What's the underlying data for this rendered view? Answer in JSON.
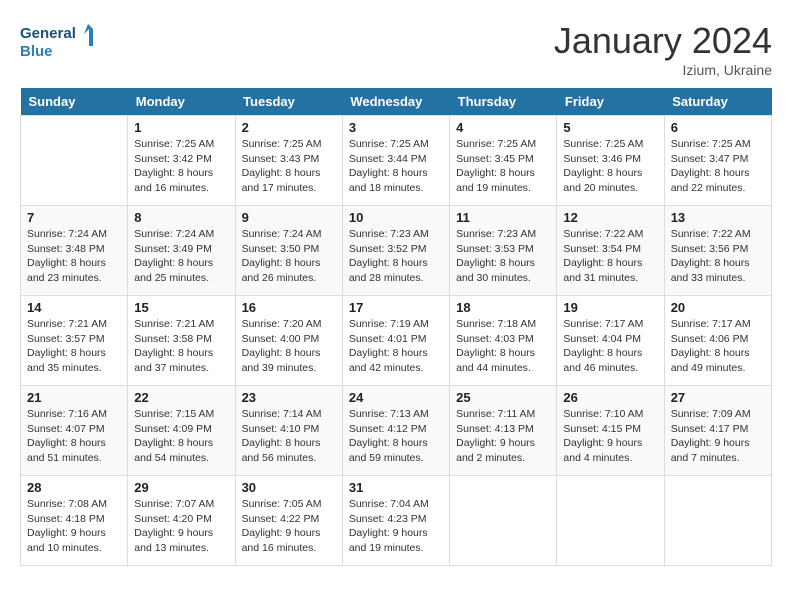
{
  "header": {
    "logo_line1": "General",
    "logo_line2": "Blue",
    "month_title": "January 2024",
    "location": "Izium, Ukraine"
  },
  "weekdays": [
    "Sunday",
    "Monday",
    "Tuesday",
    "Wednesday",
    "Thursday",
    "Friday",
    "Saturday"
  ],
  "weeks": [
    [
      {
        "day": "",
        "info": ""
      },
      {
        "day": "1",
        "info": "Sunrise: 7:25 AM\nSunset: 3:42 PM\nDaylight: 8 hours\nand 16 minutes."
      },
      {
        "day": "2",
        "info": "Sunrise: 7:25 AM\nSunset: 3:43 PM\nDaylight: 8 hours\nand 17 minutes."
      },
      {
        "day": "3",
        "info": "Sunrise: 7:25 AM\nSunset: 3:44 PM\nDaylight: 8 hours\nand 18 minutes."
      },
      {
        "day": "4",
        "info": "Sunrise: 7:25 AM\nSunset: 3:45 PM\nDaylight: 8 hours\nand 19 minutes."
      },
      {
        "day": "5",
        "info": "Sunrise: 7:25 AM\nSunset: 3:46 PM\nDaylight: 8 hours\nand 20 minutes."
      },
      {
        "day": "6",
        "info": "Sunrise: 7:25 AM\nSunset: 3:47 PM\nDaylight: 8 hours\nand 22 minutes."
      }
    ],
    [
      {
        "day": "7",
        "info": "Sunrise: 7:24 AM\nSunset: 3:48 PM\nDaylight: 8 hours\nand 23 minutes."
      },
      {
        "day": "8",
        "info": "Sunrise: 7:24 AM\nSunset: 3:49 PM\nDaylight: 8 hours\nand 25 minutes."
      },
      {
        "day": "9",
        "info": "Sunrise: 7:24 AM\nSunset: 3:50 PM\nDaylight: 8 hours\nand 26 minutes."
      },
      {
        "day": "10",
        "info": "Sunrise: 7:23 AM\nSunset: 3:52 PM\nDaylight: 8 hours\nand 28 minutes."
      },
      {
        "day": "11",
        "info": "Sunrise: 7:23 AM\nSunset: 3:53 PM\nDaylight: 8 hours\nand 30 minutes."
      },
      {
        "day": "12",
        "info": "Sunrise: 7:22 AM\nSunset: 3:54 PM\nDaylight: 8 hours\nand 31 minutes."
      },
      {
        "day": "13",
        "info": "Sunrise: 7:22 AM\nSunset: 3:56 PM\nDaylight: 8 hours\nand 33 minutes."
      }
    ],
    [
      {
        "day": "14",
        "info": "Sunrise: 7:21 AM\nSunset: 3:57 PM\nDaylight: 8 hours\nand 35 minutes."
      },
      {
        "day": "15",
        "info": "Sunrise: 7:21 AM\nSunset: 3:58 PM\nDaylight: 8 hours\nand 37 minutes."
      },
      {
        "day": "16",
        "info": "Sunrise: 7:20 AM\nSunset: 4:00 PM\nDaylight: 8 hours\nand 39 minutes."
      },
      {
        "day": "17",
        "info": "Sunrise: 7:19 AM\nSunset: 4:01 PM\nDaylight: 8 hours\nand 42 minutes."
      },
      {
        "day": "18",
        "info": "Sunrise: 7:18 AM\nSunset: 4:03 PM\nDaylight: 8 hours\nand 44 minutes."
      },
      {
        "day": "19",
        "info": "Sunrise: 7:17 AM\nSunset: 4:04 PM\nDaylight: 8 hours\nand 46 minutes."
      },
      {
        "day": "20",
        "info": "Sunrise: 7:17 AM\nSunset: 4:06 PM\nDaylight: 8 hours\nand 49 minutes."
      }
    ],
    [
      {
        "day": "21",
        "info": "Sunrise: 7:16 AM\nSunset: 4:07 PM\nDaylight: 8 hours\nand 51 minutes."
      },
      {
        "day": "22",
        "info": "Sunrise: 7:15 AM\nSunset: 4:09 PM\nDaylight: 8 hours\nand 54 minutes."
      },
      {
        "day": "23",
        "info": "Sunrise: 7:14 AM\nSunset: 4:10 PM\nDaylight: 8 hours\nand 56 minutes."
      },
      {
        "day": "24",
        "info": "Sunrise: 7:13 AM\nSunset: 4:12 PM\nDaylight: 8 hours\nand 59 minutes."
      },
      {
        "day": "25",
        "info": "Sunrise: 7:11 AM\nSunset: 4:13 PM\nDaylight: 9 hours\nand 2 minutes."
      },
      {
        "day": "26",
        "info": "Sunrise: 7:10 AM\nSunset: 4:15 PM\nDaylight: 9 hours\nand 4 minutes."
      },
      {
        "day": "27",
        "info": "Sunrise: 7:09 AM\nSunset: 4:17 PM\nDaylight: 9 hours\nand 7 minutes."
      }
    ],
    [
      {
        "day": "28",
        "info": "Sunrise: 7:08 AM\nSunset: 4:18 PM\nDaylight: 9 hours\nand 10 minutes."
      },
      {
        "day": "29",
        "info": "Sunrise: 7:07 AM\nSunset: 4:20 PM\nDaylight: 9 hours\nand 13 minutes."
      },
      {
        "day": "30",
        "info": "Sunrise: 7:05 AM\nSunset: 4:22 PM\nDaylight: 9 hours\nand 16 minutes."
      },
      {
        "day": "31",
        "info": "Sunrise: 7:04 AM\nSunset: 4:23 PM\nDaylight: 9 hours\nand 19 minutes."
      },
      {
        "day": "",
        "info": ""
      },
      {
        "day": "",
        "info": ""
      },
      {
        "day": "",
        "info": ""
      }
    ]
  ]
}
